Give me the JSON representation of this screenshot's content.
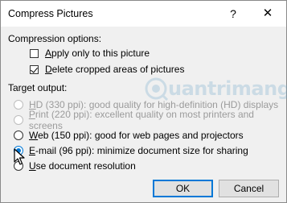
{
  "window": {
    "title": "Compress Pictures",
    "help_glyph": "?",
    "close_glyph": "✕"
  },
  "compression": {
    "heading": "Compression options:",
    "apply_only": {
      "mnemonic": "A",
      "rest": "pply only to this picture",
      "checked": false
    },
    "delete_cropped": {
      "mnemonic": "D",
      "rest": "elete cropped areas of pictures",
      "checked": true
    }
  },
  "target": {
    "heading": "Target output:",
    "options": [
      {
        "mnemonic": "H",
        "rest": "D (330 ppi): good quality for high-definition (HD) displays",
        "enabled": false,
        "selected": false
      },
      {
        "mnemonic": "P",
        "rest": "rint (220 ppi): excellent quality on most printers and screens",
        "enabled": false,
        "selected": false
      },
      {
        "mnemonic": "W",
        "rest": "eb (150 ppi): good for web pages and projectors",
        "enabled": true,
        "selected": false
      },
      {
        "mnemonic": "E",
        "rest": "-mail (96 ppi): minimize document size for sharing",
        "enabled": true,
        "selected": true
      },
      {
        "mnemonic": "U",
        "rest": "se document resolution",
        "enabled": true,
        "selected": false
      }
    ]
  },
  "buttons": {
    "ok": "OK",
    "cancel": "Cancel"
  },
  "watermark": {
    "text": "uantrimang"
  },
  "colors": {
    "accent": "#0078d7",
    "dialog_bg": "#f0f0f0",
    "disabled_text": "#9b9b9b"
  },
  "icons": {
    "cursor": "mouse-pointer-icon",
    "watermark_logo": "quantrimang-logo-icon"
  }
}
